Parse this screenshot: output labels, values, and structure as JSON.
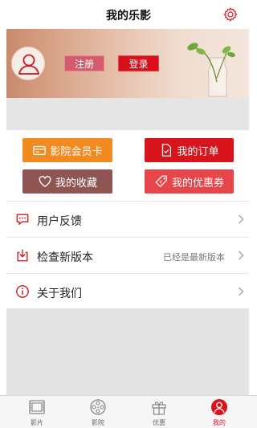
{
  "header": {
    "title": "我的乐影",
    "settings_icon": "gear-icon"
  },
  "profile": {
    "avatar_icon": "user-icon",
    "register_label": "注册",
    "login_label": "登录"
  },
  "actions": {
    "member_card": {
      "label": "影院会员卡",
      "icon": "card-icon",
      "color": "#f28a22"
    },
    "orders": {
      "label": "我的订单",
      "icon": "order-icon",
      "color": "#d8151c"
    },
    "favorites": {
      "label": "我的收藏",
      "icon": "heart-icon",
      "color": "#8f5552"
    },
    "coupons": {
      "label": "我的优惠券",
      "icon": "coupon-icon",
      "color": "#e8454a"
    }
  },
  "menu": {
    "feedback": {
      "label": "用户反馈",
      "icon": "chat-icon"
    },
    "update": {
      "label": "检查新版本",
      "status": "已经是最新版本",
      "icon": "download-icon"
    },
    "about": {
      "label": "关于我们",
      "icon": "info-icon"
    }
  },
  "tabs": [
    {
      "label": "影片",
      "icon": "film-icon",
      "active": false
    },
    {
      "label": "影院",
      "icon": "film-reel-icon",
      "active": false
    },
    {
      "label": "优惠",
      "icon": "gift-icon",
      "active": false
    },
    {
      "label": "我的",
      "icon": "user-icon",
      "active": true
    }
  ],
  "colors": {
    "accent": "#d8151c",
    "tab_active": "#d8151c"
  }
}
